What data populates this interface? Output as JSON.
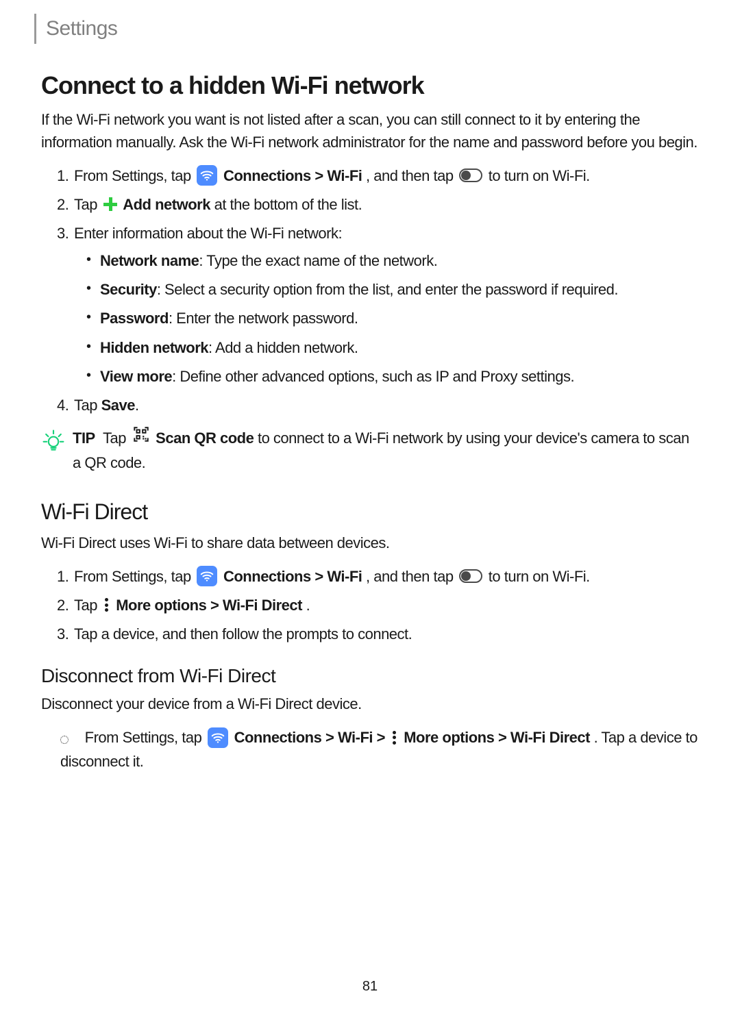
{
  "header": {
    "title": "Settings"
  },
  "s1": {
    "title": "Connect to a hidden Wi-Fi network",
    "intro": "If the Wi-Fi network you want is not listed after a scan, you can still connect to it by entering the information manually. Ask the Wi-Fi network administrator for the name and password before you begin.",
    "step1": {
      "pre": "From Settings, tap ",
      "conn": "Connections",
      "gt": " > ",
      "wifi": "Wi-Fi",
      "mid": ", and then tap ",
      "post": " to turn on Wi-Fi."
    },
    "step2": {
      "pre": "Tap ",
      "addnet": "Add network",
      "post": " at the bottom of the list."
    },
    "step3": {
      "text": "Enter information about the Wi-Fi network:"
    },
    "b1": {
      "label": "Network name",
      "text": ": Type the exact name of the network."
    },
    "b2": {
      "label": "Security",
      "text": ": Select a security option from the list, and enter the password if required."
    },
    "b3": {
      "label": "Password",
      "text": ": Enter the network password."
    },
    "b4": {
      "label": "Hidden network",
      "text": ": Add a hidden network."
    },
    "b5": {
      "label": "View more",
      "text": ": Define other advanced options, such as IP and Proxy settings."
    },
    "step4": {
      "pre": "Tap ",
      "save": "Save",
      "post": "."
    },
    "tip": {
      "label": "TIP",
      "pre": " Tap ",
      "scan": "Scan QR code",
      "post": " to connect to a Wi-Fi network by using your device's camera to scan a QR code."
    }
  },
  "s2": {
    "title": "Wi-Fi Direct",
    "intro": "Wi-Fi Direct uses Wi-Fi to share data between devices.",
    "step1": {
      "pre": "From Settings, tap ",
      "conn": "Connections",
      "gt": " > ",
      "wifi": "Wi-Fi",
      "mid": ", and then tap ",
      "post": " to turn on Wi-Fi."
    },
    "step2": {
      "pre": "Tap ",
      "more": "More options",
      "gt": " > ",
      "wfd": "Wi-Fi Direct",
      "post": "."
    },
    "step3": {
      "text": "Tap a device, and then follow the prompts to connect."
    }
  },
  "s3": {
    "title": "Disconnect from Wi-Fi Direct",
    "intro": "Disconnect your device from a Wi-Fi Direct device.",
    "step": {
      "pre": "From Settings, tap ",
      "conn": "Connections",
      "gt1": " > ",
      "wifi": "Wi-Fi",
      "gt2": " > ",
      "more": "More options",
      "gt3": " > ",
      "wfd": "Wi-Fi Direct",
      "post": ". Tap a device to disconnect it."
    }
  },
  "page_number": "81"
}
